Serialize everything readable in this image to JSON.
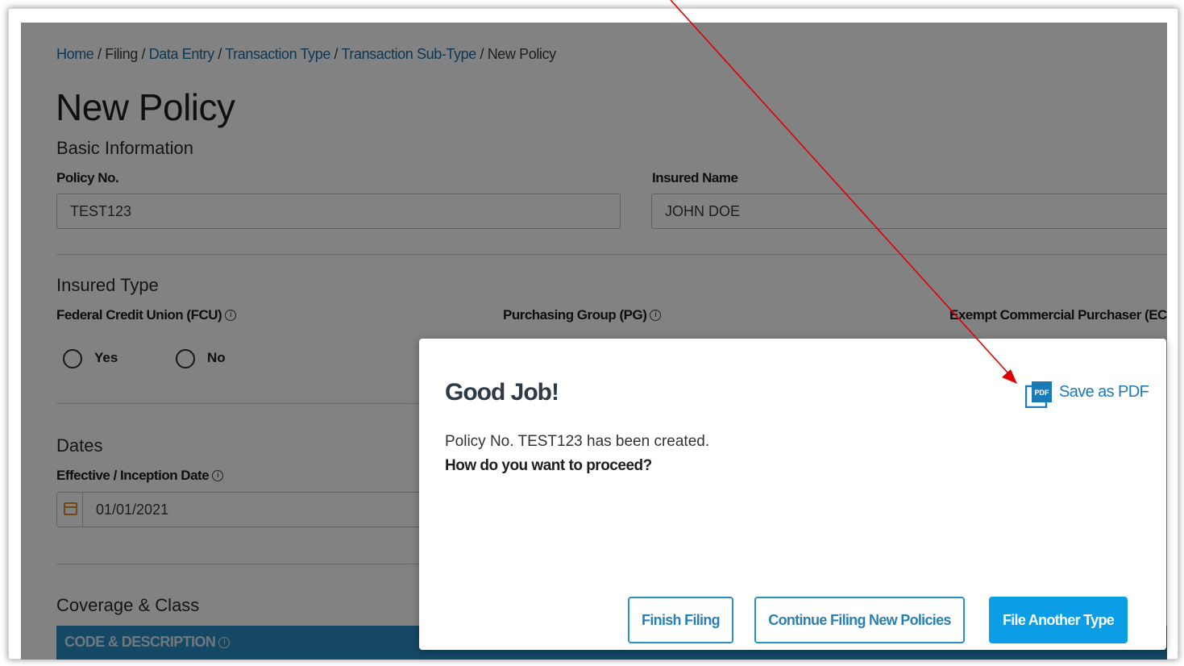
{
  "breadcrumb": {
    "home": "Home",
    "sep": "/",
    "filing": "Filing",
    "data_entry": "Data Entry",
    "transaction_type": "Transaction Type",
    "transaction_subtype": "Transaction Sub-Type",
    "current": "New Policy"
  },
  "page_title": "New Policy",
  "basic_info": {
    "title": "Basic Information",
    "policy_no_label": "Policy No.",
    "policy_no_value": "TEST123",
    "insured_name_label": "Insured Name",
    "insured_name_value": "JOHN DOE"
  },
  "insured_type": {
    "title": "Insured Type",
    "fcu_label": "Federal Credit Union (FCU)",
    "pg_label": "Purchasing Group (PG)",
    "ecp_label": "Exempt Commercial Purchaser (EC",
    "yes_label": "Yes",
    "no_label": "No",
    "info_glyph": "i"
  },
  "dates": {
    "title": "Dates",
    "effective_label": "Effective / Inception Date",
    "effective_value": "01/01/2021"
  },
  "coverage": {
    "title": "Coverage & Class",
    "code_header": "CODE & DESCRIPTION"
  },
  "modal": {
    "title": "Good Job!",
    "save_pdf": "Save as PDF",
    "pdf_icon_text": "PDF",
    "message": "Policy No. TEST123 has been created.",
    "question": "How do you want to proceed?",
    "finish_button": "Finish Filing",
    "continue_button": "Continue Filing New Policies",
    "file_another_button": "File Another Type"
  },
  "colors": {
    "link": "#1a6ea8",
    "primary": "#0b9ee6",
    "table_header": "#2a8ec7",
    "annotation_arrow": "#e00000",
    "calendar_icon": "#e28a2b"
  }
}
